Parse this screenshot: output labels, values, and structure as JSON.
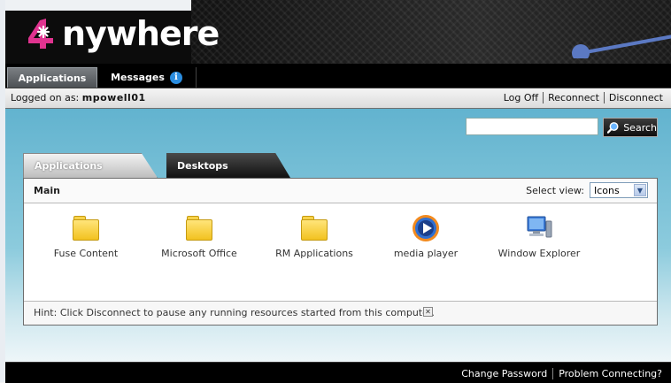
{
  "brand": {
    "logo_text": "nywhere",
    "logo_digit": "4"
  },
  "topnav": {
    "tabs": [
      {
        "label": "Applications"
      },
      {
        "label": "Messages"
      }
    ]
  },
  "userbar": {
    "logged_prefix": "Logged on as:",
    "username": "mpowell01",
    "links": [
      "Log Off",
      "Reconnect",
      "Disconnect"
    ]
  },
  "search": {
    "value": "",
    "button_label": "Search"
  },
  "content_tabs": [
    {
      "label": "Applications"
    },
    {
      "label": "Desktops"
    }
  ],
  "panel": {
    "title": "Main",
    "view_label": "Select view:",
    "view_value": "Icons",
    "items": [
      {
        "label": "Fuse Content",
        "icon": "folder-icon"
      },
      {
        "label": "Microsoft Office",
        "icon": "folder-icon"
      },
      {
        "label": "RM Applications",
        "icon": "folder-icon"
      },
      {
        "label": "media player",
        "icon": "media-player-icon"
      },
      {
        "label": "Window Explorer",
        "icon": "computer-icon"
      }
    ],
    "hint": "Hint: Click Disconnect to pause any running resources started from this computer."
  },
  "footer": {
    "links": [
      "Change Password",
      "Problem Connecting?"
    ]
  },
  "colors": {
    "accent_pink": "#e0338f",
    "bg_teal": "#62b3cf",
    "info_blue": "#2a8de0"
  }
}
